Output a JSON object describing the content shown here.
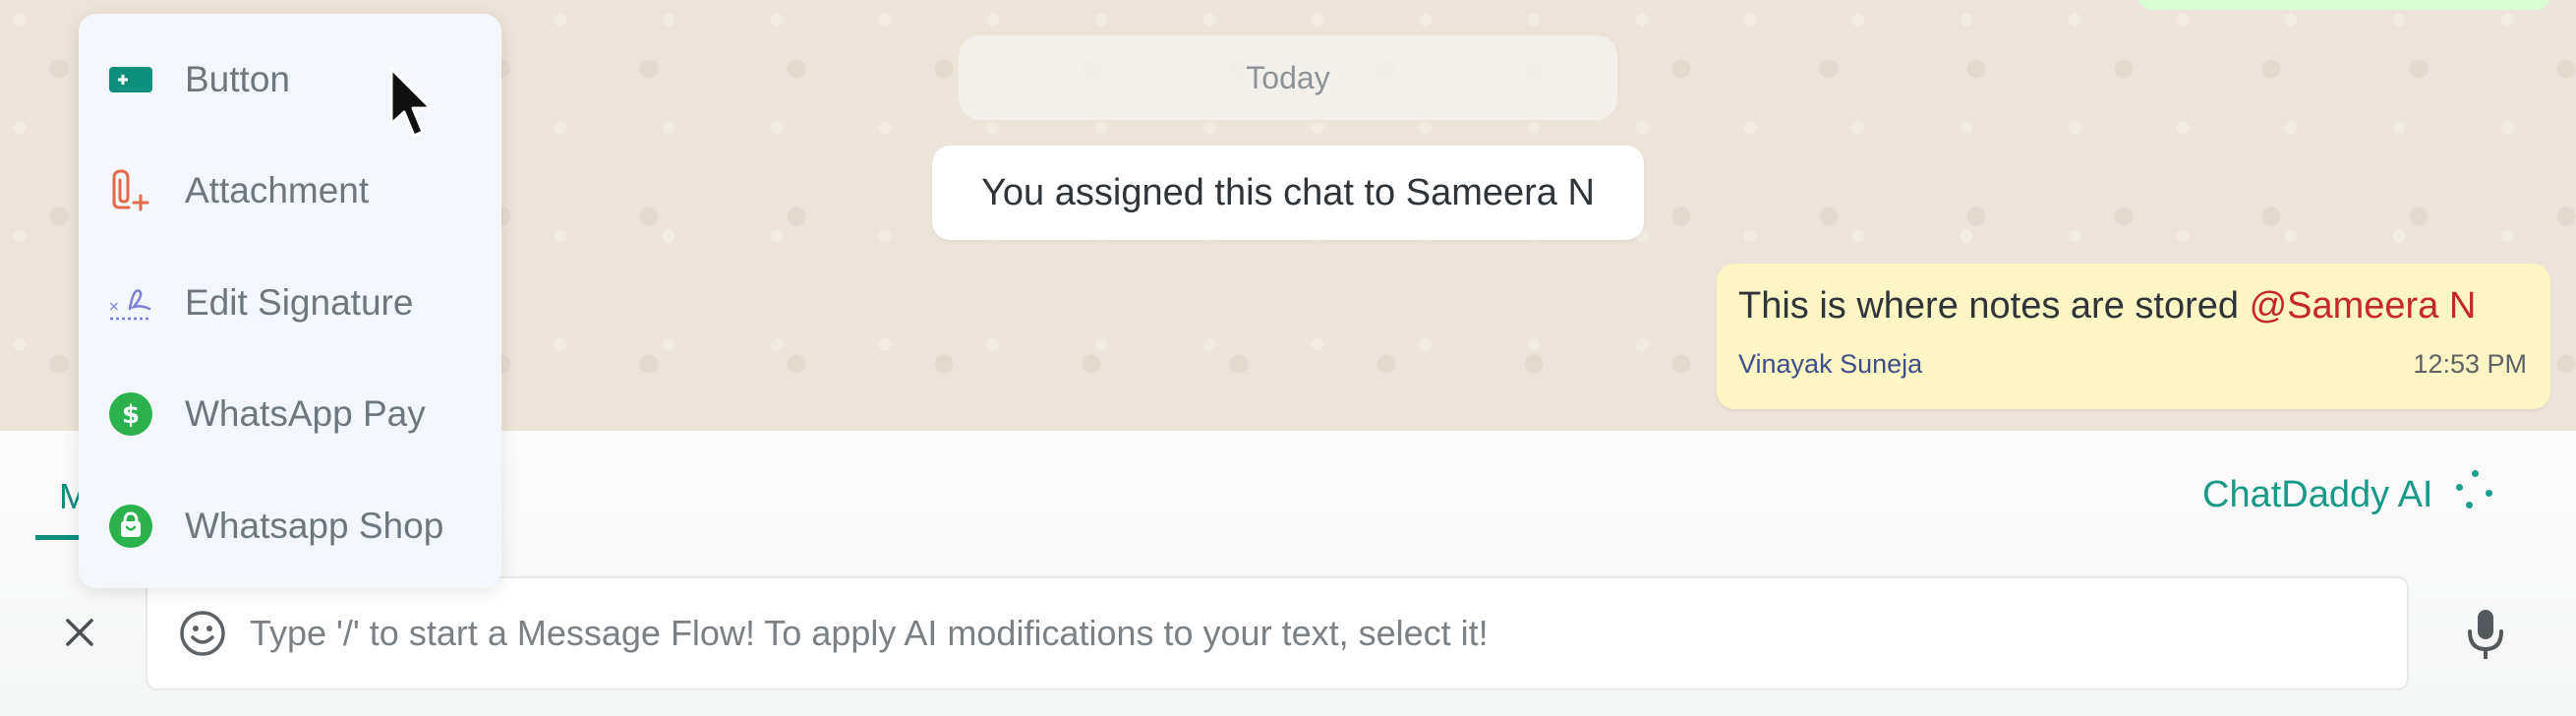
{
  "chat": {
    "date_chip": "Today",
    "system_message": "You assigned this chat to Sameera N",
    "note": {
      "text": "This is where notes are stored ",
      "mention": "@Sameera N",
      "author": "Vinayak Suneja",
      "time": "12:53 PM",
      "background": "#fdf5c4"
    }
  },
  "attach_menu": {
    "items": [
      {
        "label": "Button",
        "icon": "button-icon",
        "color": "#0c8f7d"
      },
      {
        "label": "Attachment",
        "icon": "attachment-icon",
        "color": "#e06c4a"
      },
      {
        "label": "Edit Signature",
        "icon": "signature-icon",
        "color": "#7b7fd4"
      },
      {
        "label": "WhatsApp Pay",
        "icon": "whatsapp-pay-icon",
        "color": "#2bb24c"
      },
      {
        "label": "Whatsapp Shop",
        "icon": "whatsapp-shop-icon",
        "color": "#2bb24c"
      }
    ]
  },
  "composer": {
    "tab_partial_label": "M",
    "ai_label": "ChatDaddy AI",
    "placeholder": "Type '/' to start a Message Flow! To apply AI modifications to your text, select it!",
    "value": ""
  },
  "colors": {
    "accent": "#0c8f7d",
    "mention": "#c62828",
    "author": "#3d4f8a"
  }
}
